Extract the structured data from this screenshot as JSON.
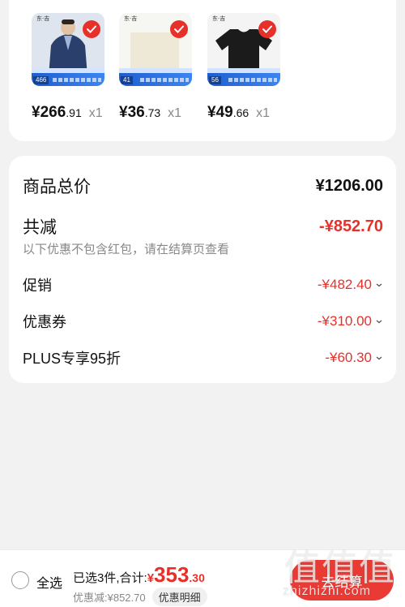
{
  "products": [
    {
      "price_int": "¥266",
      "price_dec": ".91",
      "qty": "x1",
      "badge": "466",
      "brand": "东·吉",
      "shirt_color": "#2a3f6b"
    },
    {
      "price_int": "¥36",
      "price_dec": ".73",
      "qty": "x1",
      "badge": "41",
      "brand": "东·吉",
      "shirt_color": "#eee8d6"
    },
    {
      "price_int": "¥49",
      "price_dec": ".66",
      "qty": "x1",
      "badge": "56",
      "brand": "东·吉",
      "shirt_color": "#1b1b1b"
    }
  ],
  "summary": {
    "total_label": "商品总价",
    "total_value": "¥1206.00",
    "reduce_label": "共减",
    "reduce_value": "-¥852.70",
    "reduce_note": "以下优惠不包含红包，请在结算页查看",
    "items": [
      {
        "label": "促销",
        "value": "-¥482.40"
      },
      {
        "label": "优惠券",
        "value": "-¥310.00"
      },
      {
        "label": "PLUS专享95折",
        "value": "-¥60.30"
      }
    ]
  },
  "bottom": {
    "select_all": "全选",
    "selected_text": "已选3件,合计:",
    "total_symbol": "¥",
    "total_int": "353",
    "total_dec": ".30",
    "discount_text": "优惠减:¥852.70",
    "detail_btn": "优惠明细",
    "checkout": "去结算"
  },
  "watermark": {
    "logo": "值值值",
    "url": "zhizhizhi.com"
  },
  "colors": {
    "accent": "#e8302a",
    "background": "#f2f2f2"
  }
}
